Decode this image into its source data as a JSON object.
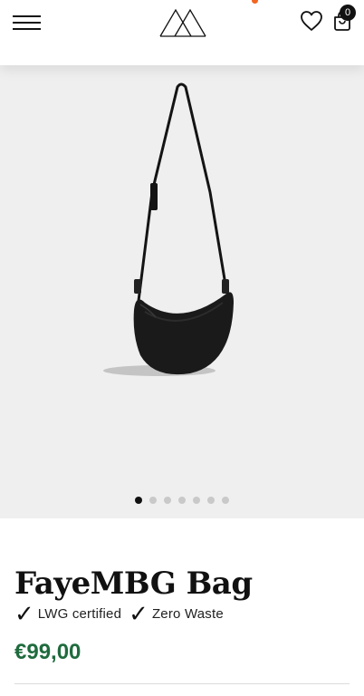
{
  "header": {
    "cart_count": "0"
  },
  "gallery": {
    "slide_count": 7,
    "active_index": 0
  },
  "product": {
    "title": "FayeMBG Bag",
    "badges": [
      {
        "check": "✓",
        "label": "LWG certified"
      },
      {
        "check": "✓",
        "label": "Zero Waste"
      }
    ],
    "price": "€99,00"
  },
  "colors": {
    "price": "#1f6b3d",
    "notify_dot": "#f26522",
    "gallery_bg": "#efefef"
  }
}
